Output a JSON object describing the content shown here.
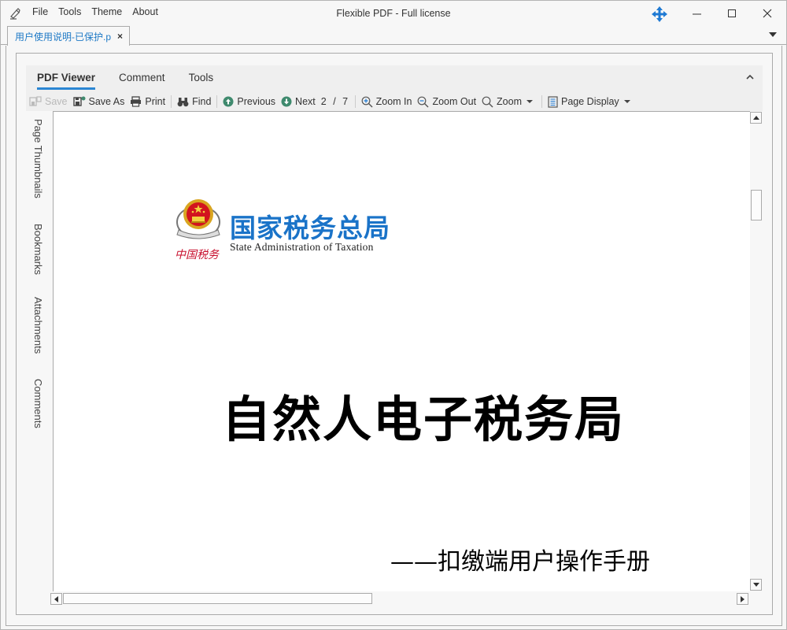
{
  "app": {
    "title": "Flexible PDF - Full license",
    "menu": [
      "File",
      "Tools",
      "Theme",
      "About"
    ]
  },
  "document_tab": {
    "label": "用户使用说明-已保护.pdf",
    "close_glyph": "×"
  },
  "ribbon": {
    "tabs": [
      {
        "label": "PDF Viewer",
        "active": true
      },
      {
        "label": "Comment",
        "active": false
      },
      {
        "label": "Tools",
        "active": false
      }
    ],
    "toolbar": {
      "save": "Save",
      "save_as": "Save As",
      "print": "Print",
      "find": "Find",
      "previous": "Previous",
      "next": "Next",
      "current_page": "2",
      "page_sep": "/",
      "total_pages": "7",
      "zoom_in": "Zoom In",
      "zoom_out": "Zoom Out",
      "zoom": "Zoom",
      "page_display": "Page Display"
    }
  },
  "side_panel": {
    "tabs": [
      "Page Thumbnails",
      "Bookmarks",
      "Attachments",
      "Comments"
    ]
  },
  "page": {
    "logo_cn": "国家税务总局",
    "logo_en": "State Administration of Taxation",
    "logo_handwriting": "中国税务",
    "title": "自然人电子税务局",
    "subtitle": "——扣缴端用户操作手册"
  },
  "colors": {
    "accent": "#2b86d3",
    "tab_text": "#1f7ac6",
    "logo_blue": "#1a73c8",
    "nav_green": "#3f8a6e",
    "seal_red": "#c8102e"
  }
}
